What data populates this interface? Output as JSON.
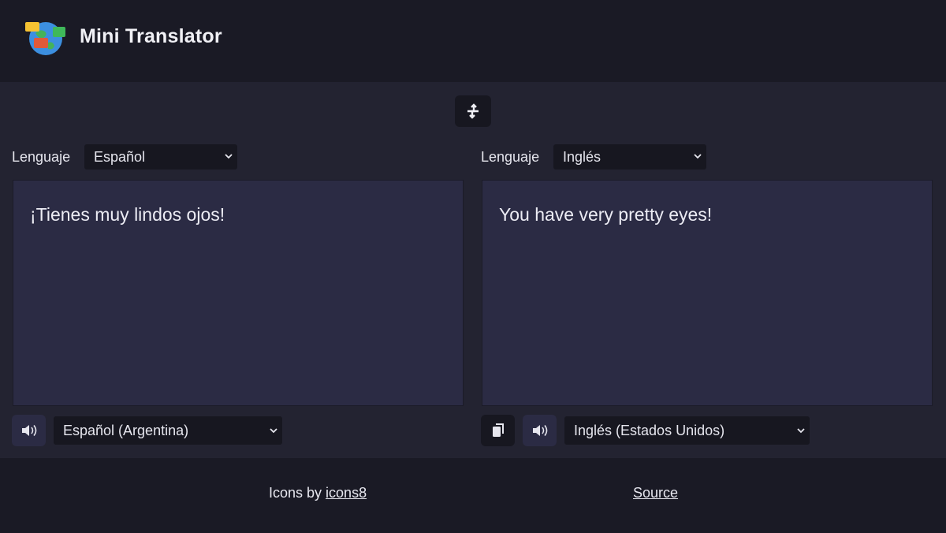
{
  "header": {
    "title": "Mini Translator",
    "logo_icon": "globe-chat-logo-icon"
  },
  "swap": {
    "icon": "swap-arrows-icon"
  },
  "source": {
    "language_label": "Lenguaje",
    "language_selected": "Español",
    "text": "¡Tienes muy lindos ojos!",
    "speak_icon": "speaker-icon",
    "voice_selected": "Español (Argentina)"
  },
  "target": {
    "language_label": "Lenguaje",
    "language_selected": "Inglés",
    "text": "You have very pretty eyes!",
    "copy_icon": "copy-icon",
    "speak_icon": "speaker-icon",
    "voice_selected": "Inglés (Estados Unidos)"
  },
  "footer": {
    "credit_prefix": "Icons by ",
    "credit_link": "icons8",
    "source_link": "Source"
  },
  "colors": {
    "header_bg": "#1a1a25",
    "main_bg": "#232331",
    "textbox_bg": "#2b2b44",
    "control_bg": "#171720"
  }
}
